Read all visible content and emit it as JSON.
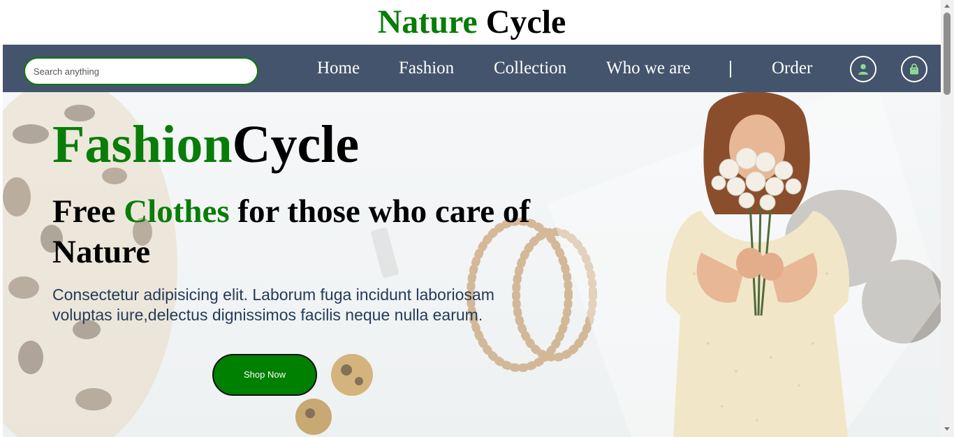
{
  "brand": {
    "word1": "Nature",
    "word2": "Cycle"
  },
  "search": {
    "placeholder": "Search anything",
    "value": ""
  },
  "nav": {
    "links": [
      "Home",
      "Fashion",
      "Collection",
      "Who we are",
      "Order"
    ],
    "icons": [
      "user-icon",
      "shopping-bag-icon"
    ]
  },
  "hero": {
    "title_green": "Fashion",
    "title_black": "Cycle",
    "subtitle_pre": "Free ",
    "subtitle_green": "Clothes",
    "subtitle_post": " for those who care of Nature",
    "description": "Consectetur adipisicing elit. Laborum fuga incidunt laboriosam voluptas iure,delectus dignissimos facilis neque nulla earum.",
    "button_label": "Shop Now"
  },
  "colors": {
    "brand_green": "#067d06",
    "nav_bg": "#44546c",
    "button_green": "#008000",
    "icon_green": "#8fd890",
    "desc_text": "#243b5a"
  }
}
